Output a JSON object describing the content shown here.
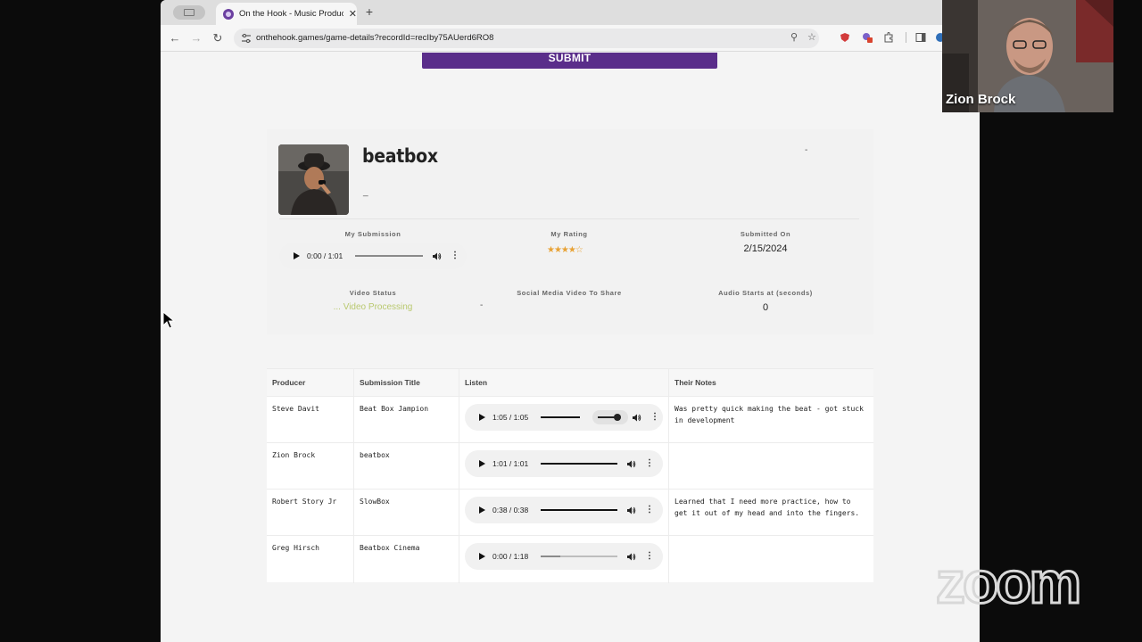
{
  "browser": {
    "tab_title": "On the Hook - Music Producer",
    "tab_close": "✕",
    "new_tab": "+",
    "url": "onthehook.games/game-details?recordId=recIby75AUerd6RO8"
  },
  "page": {
    "submit_label": "SUBMIT",
    "beat": {
      "title": "beatbox",
      "subtitle": "_",
      "dash_right": "-"
    },
    "my_submission": {
      "label": "My Submission",
      "time": "0:00 / 1:01",
      "progress": 0
    },
    "my_rating": {
      "label": "My Rating",
      "stars_filled": 4,
      "stars_total": 5,
      "stars_glyph": "★★★★☆"
    },
    "submitted_on": {
      "label": "Submitted On",
      "value": "2/15/2024"
    },
    "video_status": {
      "label": "Video Status",
      "value": "... Video Processing",
      "color": "#b9c96f"
    },
    "social_video": {
      "label": "Social Media Video To Share",
      "value": "-"
    },
    "audio_start": {
      "label": "Audio Starts at (seconds)",
      "value": "0"
    }
  },
  "table": {
    "headers": [
      "Producer",
      "Submission Title",
      "Listen",
      "Their Notes"
    ],
    "rows": [
      {
        "producer": "Steve Davit",
        "title": "Beat Box Jampion",
        "time": "1:05 / 1:05",
        "progress": 1.0,
        "notes": "Was pretty quick making the beat - got stuck in development"
      },
      {
        "producer": "Zion Brock",
        "title": "beatbox",
        "time": "1:01 / 1:01",
        "progress": 1.0,
        "notes": ""
      },
      {
        "producer": "Robert Story Jr",
        "title": "SlowBox",
        "time": "0:38 / 0:38",
        "progress": 1.0,
        "notes": "Learned that I need more practice, how to get it out of my head and into the fingers."
      },
      {
        "producer": "Greg Hirsch",
        "title": "Beatbox Cinema",
        "time": "0:00 / 1:18",
        "progress": 0.0,
        "notes": ""
      }
    ]
  },
  "zoom": {
    "participant_name": "Zion Brock",
    "logo_text": "zoom"
  },
  "colors": {
    "accent": "#5a2d8a",
    "star": "#e8a235"
  }
}
